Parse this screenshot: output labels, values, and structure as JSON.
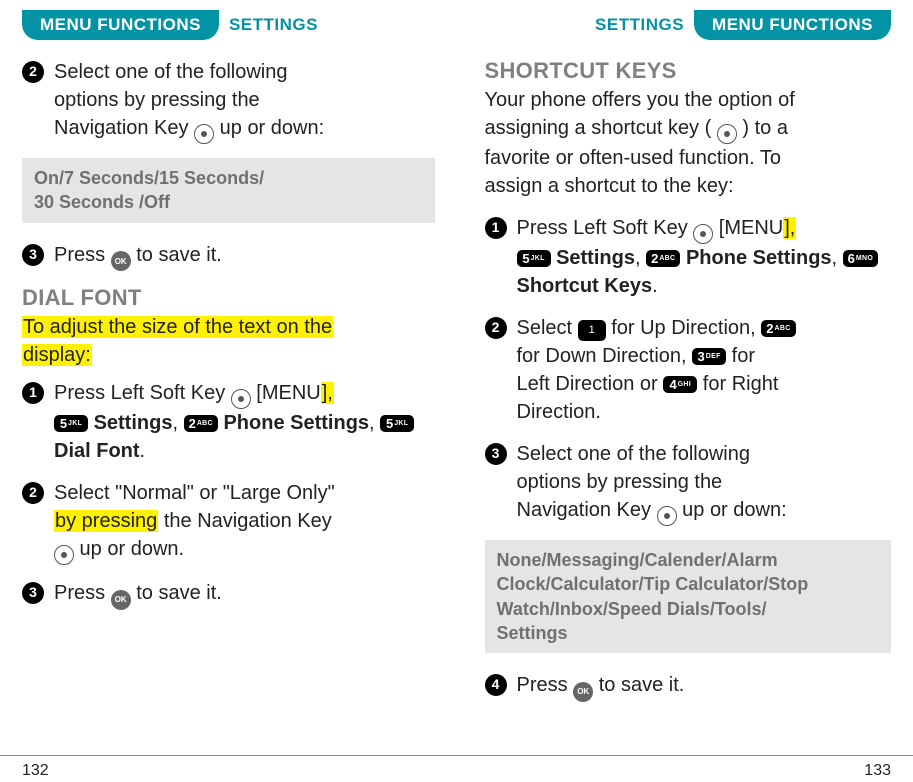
{
  "header": {
    "menu_functions": "MENU FUNCTIONS",
    "settings": "SETTINGS"
  },
  "left": {
    "step2": {
      "num": "2",
      "line1": "Select one of the following",
      "line2": "options by pressing the",
      "line3a": "Navigation Key ",
      "line3b": " up or down:"
    },
    "options_box": {
      "line1": "On/7 Seconds/15 Seconds/",
      "line2": "30 Seconds /Off"
    },
    "step3": {
      "num": "3",
      "a": "Press ",
      "ok": "OK",
      "b": " to save it."
    },
    "dial_font": {
      "title": "DIAL FONT",
      "intro_a": "To adjust the size of the text on the",
      "intro_b": "display:"
    },
    "df_step1": {
      "num": "1",
      "a": "Press Left Soft Key ",
      "menu_a": " [MENU",
      "menu_b": "],",
      "settings": "Settings",
      "comma1": ", ",
      "phone_settings": "Phone Settings",
      "comma2": ", ",
      "dial_font": "Dial Font",
      "period": "."
    },
    "df_step2": {
      "num": "2",
      "a": "Select \"Normal\" or \"Large Only\"",
      "b_hl": "by pressing",
      "b_rest": " the Navigation Key",
      "c": " up or down."
    },
    "df_step3": {
      "num": "3",
      "a": "Press ",
      "ok": "OK",
      "b": " to save it."
    },
    "keys": {
      "k5": {
        "d": "5",
        "t": "JKL"
      },
      "k2": {
        "d": "2",
        "t": "ABC"
      }
    }
  },
  "right": {
    "shortcut": {
      "title": "SHORTCUT KEYS",
      "intro1": "Your phone offers you the option of",
      "intro2a": "assigning a shortcut key ( ",
      "intro2b": " ) to a",
      "intro3": "favorite or often-used function. To",
      "intro4": "assign a shortcut to the key:"
    },
    "sk_step1": {
      "num": "1",
      "a": "Press Left Soft Key ",
      "menu_a": " [MENU",
      "menu_b": "],",
      "settings": "Settings",
      "comma1": ", ",
      "phone_settings": "Phone Settings",
      "comma2": ", ",
      "shortcut_keys": "Shortcut Keys",
      "period": "."
    },
    "sk_step2": {
      "num": "2",
      "a": "Select ",
      "b": " for Up Direction, ",
      "c": "for Down Direction, ",
      "d": " for",
      "e": "Left Direction or ",
      "f": " for Right",
      "g": "Direction."
    },
    "sk_step3": {
      "num": "3",
      "line1": "Select one of the following",
      "line2": "options by pressing the",
      "line3a": "Navigation Key ",
      "line3b": " up or down:"
    },
    "options_box": {
      "line1": "None/Messaging/Calender/Alarm",
      "line2": "Clock/Calculator/Tip Calculator/Stop",
      "line3": "Watch/Inbox/Speed Dials/Tools/",
      "line4": "Settings"
    },
    "sk_step4": {
      "num": "4",
      "a": "Press ",
      "ok": "OK",
      "b": " to save it."
    },
    "keys": {
      "k1": {
        "d": "1",
        "t": "  "
      },
      "k2": {
        "d": "2",
        "t": "ABC"
      },
      "k3": {
        "d": "3",
        "t": "DEF"
      },
      "k4": {
        "d": "4",
        "t": "GHI"
      },
      "k5": {
        "d": "5",
        "t": "JKL"
      },
      "k6": {
        "d": "6",
        "t": "MNO"
      }
    }
  },
  "footer": {
    "left": "132",
    "right": "133"
  }
}
